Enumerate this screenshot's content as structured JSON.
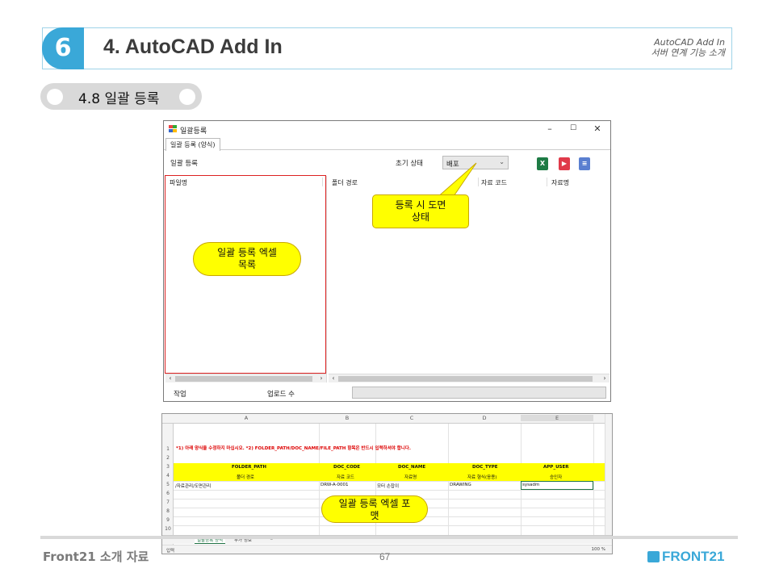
{
  "slide": {
    "section_number": "6",
    "section_title": "4. AutoCAD Add In",
    "header_sub1": "AutoCAD Add In",
    "header_sub2": "서버 연계 기능 소개",
    "subsection": "4.8 일괄 등록"
  },
  "window": {
    "title": "일괄등록",
    "controls": [
      "–",
      "☐",
      "✕"
    ],
    "tab": "일괄 등록 (양식)",
    "toolbar_label": "일괄 등록",
    "state_label": "초기 상태",
    "state_value": "배포",
    "icons": [
      "excel-icon",
      "run-icon",
      "log-icon"
    ],
    "left_columns": [
      "파일명"
    ],
    "right_columns": [
      "폴더 경로",
      "자료 코드",
      "자료명"
    ],
    "status_work": "작업",
    "status_upload": "업로드 수"
  },
  "callouts": {
    "state_note": "등록 시 도면\n상태",
    "list_note": "일괄 등록 엑셀\n목록",
    "format_note": "일괄 등록 엑셀 포\n맷"
  },
  "excel": {
    "columns": [
      "A",
      "B",
      "C",
      "D",
      "E"
    ],
    "rows": [
      "1",
      "2",
      "3",
      "4",
      "5",
      "6",
      "7",
      "8",
      "9",
      "10",
      "11"
    ],
    "note": "*1) 아래 양식을 수정하지 마십시오.    *2) FOLDER_PATH/DOC_NAME/FILE_PATH 항목은 반드시 입력하셔야 합니다.",
    "header_row": [
      "FOLDER_PATH",
      "DOC_CODE",
      "DOC_NAME",
      "DOC_TYPE",
      "APP_USER"
    ],
    "desc_row": [
      "폴더 경로",
      "자료 코드",
      "자료명",
      "자료 형식(응용)",
      "승인자"
    ],
    "data_row": [
      "/자료관리/도면관리",
      "DRW-A-0001",
      "모터 손잡이",
      "DRAWING",
      "sysadm"
    ],
    "sheets": [
      "일괄등록 양식",
      "부가 정보"
    ],
    "status_left": "입력",
    "zoom": "100 %"
  },
  "footer": {
    "left": "Front21 소개 자료",
    "page": "67",
    "logo": "FRONT21"
  },
  "colors": {
    "accent": "#3aa8d8",
    "callout": "#ffff00",
    "highlight_red": "#dd2222"
  }
}
